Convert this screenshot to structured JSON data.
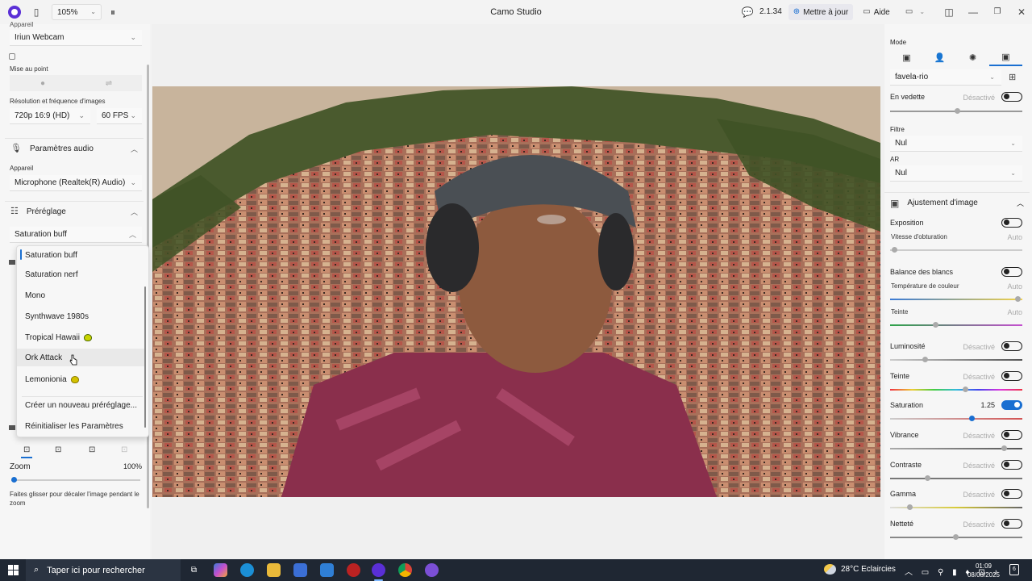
{
  "titlebar": {
    "zoom": "105%",
    "title": "Camo Studio",
    "version": "2.1.34",
    "update_label": "Mettre à jour",
    "help_label": "Aide"
  },
  "left": {
    "device_label": "Appareil",
    "device_value": "Iriun Webcam",
    "focus_label": "Mise au point",
    "resolution_label": "Résolution et fréquence d'images",
    "resolution_value": "720p 16:9 (HD)",
    "fps_value": "60 FPS",
    "audio_section": "Paramètres audio",
    "audio_device_label": "Appareil",
    "audio_device_value": "Microphone (Realtek(R) Audio)",
    "preset_section": "Préréglage",
    "preset_value": "Saturation buff",
    "zoom_label": "Zoom",
    "zoom_value": "100%",
    "zoom_hint": "Faites glisser pour décaler l'image pendant le zoom"
  },
  "dropdown": {
    "items": [
      {
        "label": "Saturation buff"
      },
      {
        "label": "Saturation nerf"
      },
      {
        "label": "Mono"
      },
      {
        "label": "Synthwave 1980s"
      },
      {
        "label": "Tropical Hawaii"
      },
      {
        "label": "Ork Attack"
      },
      {
        "label": "Lemonionia"
      }
    ],
    "create_label": "Créer un nouveau préréglage...",
    "reset_label": "Réinitialiser les Paramètres"
  },
  "right": {
    "mode_label": "Mode",
    "background_value": "favela-rio",
    "spotlight_label": "En vedette",
    "spotlight_state": "Désactivé",
    "filter_label": "Filtre",
    "filter_value": "Nul",
    "ar_label": "AR",
    "ar_value": "Nul",
    "image_section": "Ajustement d'image",
    "exposure_label": "Exposition",
    "shutter_label": "Vitesse d'obturation",
    "shutter_state": "Auto",
    "wb_label": "Balance des blancs",
    "color_temp_label": "Température de couleur",
    "color_temp_state": "Auto",
    "tint_label": "Teinte",
    "tint_state": "Auto",
    "luminosity_label": "Luminosité",
    "luminosity_state": "Désactivé",
    "hue_label": "Teinte",
    "hue_state": "Désactivé",
    "saturation_label": "Saturation",
    "saturation_value": "1.25",
    "vibrance_label": "Vibrance",
    "vibrance_state": "Désactivé",
    "contrast_label": "Contraste",
    "contrast_state": "Désactivé",
    "gamma_label": "Gamma",
    "gamma_state": "Désactivé",
    "sharpness_label": "Netteté",
    "sharpness_state": "Désactivé"
  },
  "taskbar": {
    "search_placeholder": "Taper ici pour rechercher",
    "weather": "28°C  Eclaircies",
    "time": "01:09",
    "date": "08/08/2025",
    "notifications": "6"
  },
  "colors": {
    "accent": "#1a6fd1",
    "app_purple": "#5a2fd6",
    "taskbar": "#1f2733"
  }
}
